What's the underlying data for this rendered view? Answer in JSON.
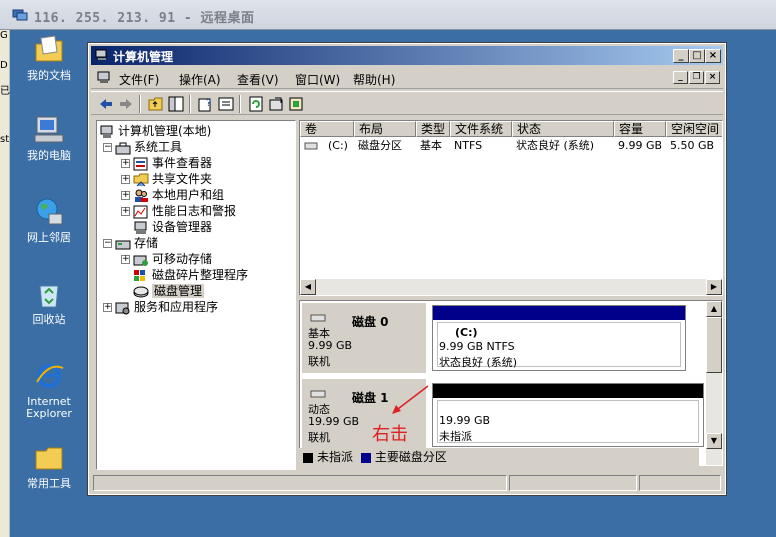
{
  "remote": {
    "title": "116. 255. 213. 91 - 远程桌面"
  },
  "strip": {
    "glyphs": [
      "G",
      "D",
      "已",
      "st"
    ]
  },
  "desktop_icons": [
    {
      "label": "我的文档"
    },
    {
      "label": "我的电脑"
    },
    {
      "label": "网上邻居"
    },
    {
      "label": "回收站"
    },
    {
      "label_line1": "Internet",
      "label_line2": "Explorer"
    },
    {
      "label": "常用工具"
    }
  ],
  "window": {
    "title": "计算机管理",
    "menu": [
      "文件(F)",
      "操作(A)",
      "查看(V)",
      "窗口(W)",
      "帮助(H)"
    ]
  },
  "tree": {
    "root": "计算机管理(本地)",
    "system_tools": "系统工具",
    "event_viewer": "事件查看器",
    "shared_folders": "共享文件夹",
    "local_users": "本地用户和组",
    "perf_logs": "性能日志和警报",
    "device_manager": "设备管理器",
    "storage": "存储",
    "removable": "可移动存储",
    "defrag": "磁盘碎片整理程序",
    "disk_mgmt": "磁盘管理",
    "services": "服务和应用程序"
  },
  "volume_list": {
    "headers": [
      "卷",
      "布局",
      "类型",
      "文件系统",
      "状态",
      "容量",
      "空闲空间"
    ],
    "rows": [
      [
        "(C:)",
        "磁盘分区",
        "基本",
        "NTFS",
        "状态良好 (系统)",
        "9.99 GB",
        "5.50 GB"
      ]
    ]
  },
  "disks": [
    {
      "name": "磁盘 0",
      "type": "基本",
      "size": "9.99 GB",
      "status": "联机",
      "partition": {
        "label": "(C:)",
        "detail": "9.99 GB NTFS",
        "status": "状态良好 (系统)",
        "bar_color": "#00008b"
      }
    },
    {
      "name": "磁盘 1",
      "type": "动态",
      "size": "19.99 GB",
      "status": "联机",
      "partition": {
        "label": "",
        "detail": "19.99 GB",
        "status": "未指派",
        "bar_color": "#000000"
      }
    }
  ],
  "legend": {
    "unallocated": "未指派",
    "unallocated_color": "#000000",
    "primary": "主要磁盘分区",
    "primary_color": "#00008b"
  },
  "annotation": {
    "text": "右击",
    "color": "#e02020"
  }
}
